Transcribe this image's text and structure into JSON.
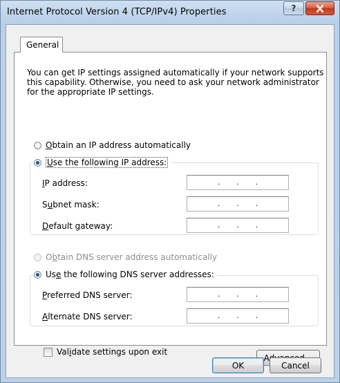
{
  "window": {
    "title": "Internet Protocol Version 4 (TCP/IPv4) Properties",
    "help_glyph": "?",
    "close_icon": "close-icon"
  },
  "tabs": [
    {
      "label": "General",
      "selected": true
    }
  ],
  "description": "You can get IP settings assigned automatically if your network supports this capability. Otherwise, you need to ask your network administrator for the appropriate IP settings.",
  "ip": {
    "auto": {
      "prefix": "",
      "accel": "O",
      "rest": "btain an IP address automatically",
      "checked": false
    },
    "manual": {
      "prefix": "",
      "accel": "U",
      "rest": "se the following IP address:",
      "checked": true
    },
    "fields": [
      {
        "prefix": "",
        "accel": "I",
        "rest": "P address:",
        "value": ". . ."
      },
      {
        "prefix": "S",
        "accel": "u",
        "rest": "bnet mask:",
        "value": ". . ."
      },
      {
        "prefix": "",
        "accel": "D",
        "rest": "efault gateway:",
        "value": ". . ."
      }
    ]
  },
  "dns": {
    "auto": {
      "prefix": "O",
      "accel": "b",
      "rest": "tain DNS server address automatically",
      "checked": false,
      "disabled": true
    },
    "manual": {
      "prefix": "Us",
      "accel": "e",
      "rest": " the following DNS server addresses:",
      "checked": true
    },
    "fields": [
      {
        "prefix": "",
        "accel": "P",
        "rest": "referred DNS server:",
        "value": ". . ."
      },
      {
        "prefix": "",
        "accel": "A",
        "rest": "lternate DNS server:",
        "value": ". . ."
      }
    ]
  },
  "validate": {
    "prefix": "Val",
    "accel": "i",
    "rest": "date settings upon exit",
    "checked": false
  },
  "buttons": {
    "advanced": {
      "prefix": "Ad",
      "accel": "v",
      "rest": "anced..."
    },
    "ok": "OK",
    "cancel": "Cancel"
  }
}
